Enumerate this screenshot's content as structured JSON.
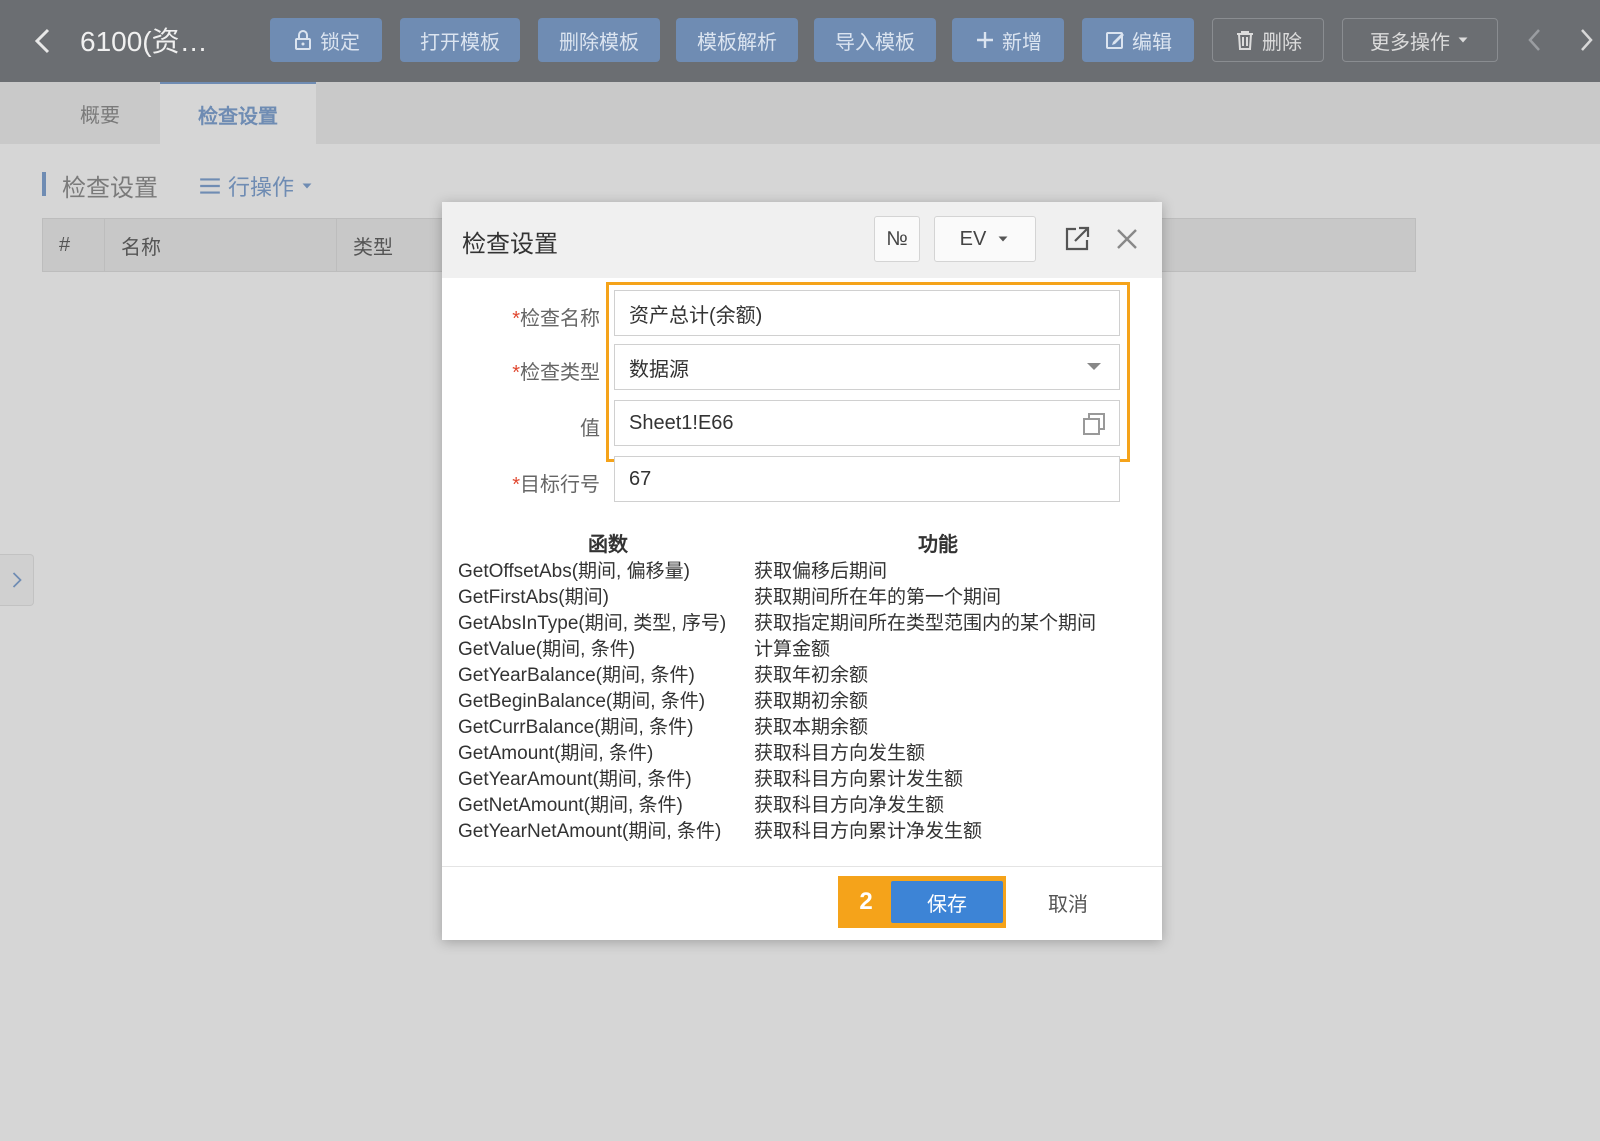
{
  "toolbar": {
    "title": "6100(资…",
    "buttons": {
      "lock": "锁定",
      "open_template": "打开模板",
      "delete_template": "删除模板",
      "parse_template": "模板解析",
      "import_template": "导入模板",
      "add": "新增",
      "edit": "编辑",
      "delete": "删除",
      "more": "更多操作"
    }
  },
  "tabs": [
    "概要",
    "检查设置"
  ],
  "section": {
    "title": "检查设置",
    "row_ops": "行操作"
  },
  "table": {
    "headers": [
      "#",
      "名称",
      "类型"
    ]
  },
  "dialog": {
    "title": "检查设置",
    "no_button": "№",
    "ev_button": "EV",
    "fields": {
      "name_label": "检查名称",
      "name_value": "资产总计(余额)",
      "type_label": "检查类型",
      "type_value": "数据源",
      "value_label": "值",
      "value_value": "Sheet1!E66",
      "target_label": "目标行号",
      "target_value": "67"
    },
    "required_mark": "*",
    "functions_header": "函数",
    "description_header": "功能",
    "functions": [
      {
        "fn": "GetOffsetAbs(期间, 偏移量)",
        "desc": "获取偏移后期间"
      },
      {
        "fn": "GetFirstAbs(期间)",
        "desc": "获取期间所在年的第一个期间"
      },
      {
        "fn": "GetAbsInType(期间, 类型, 序号)",
        "desc": "获取指定期间所在类型范围内的某个期间"
      },
      {
        "fn": "GetValue(期间, 条件)",
        "desc": "计算金额"
      },
      {
        "fn": "GetYearBalance(期间, 条件)",
        "desc": "获取年初余额"
      },
      {
        "fn": "GetBeginBalance(期间, 条件)",
        "desc": "获取期初余额"
      },
      {
        "fn": "GetCurrBalance(期间, 条件)",
        "desc": "获取本期余额"
      },
      {
        "fn": "GetAmount(期间, 条件)",
        "desc": "获取科目方向发生额"
      },
      {
        "fn": "GetYearAmount(期间, 条件)",
        "desc": "获取科目方向累计发生额"
      },
      {
        "fn": "GetNetAmount(期间, 条件)",
        "desc": "获取科目方向净发生额"
      },
      {
        "fn": "GetYearNetAmount(期间, 条件)",
        "desc": "获取科目方向累计净发生额"
      }
    ],
    "step_number": "2",
    "save_label": "保存",
    "cancel_label": "取消"
  },
  "colors": {
    "accent": "#6f8cb3",
    "highlight": "#f5a31a",
    "primary_button": "#3d84d6",
    "required": "#e0472f"
  }
}
